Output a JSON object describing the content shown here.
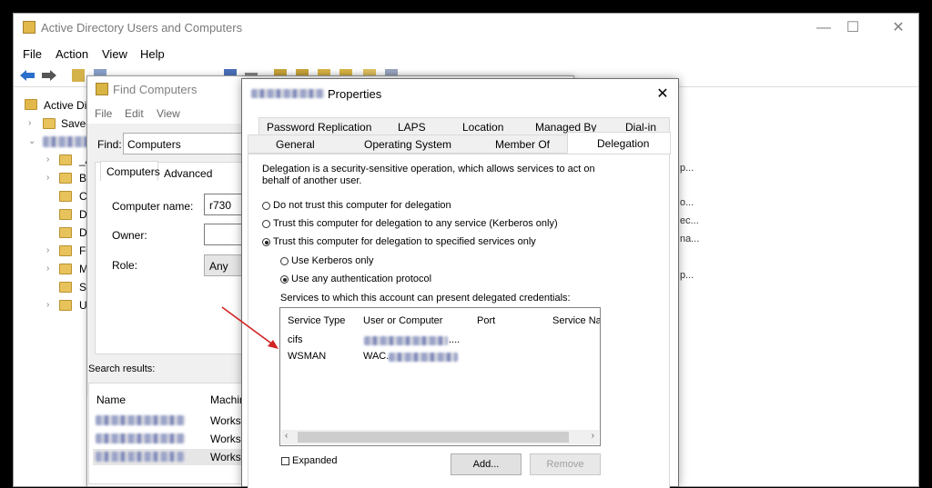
{
  "main": {
    "title": "Active Directory Users and Computers",
    "menu": [
      "File",
      "Action",
      "View",
      "Help"
    ],
    "tree": [
      {
        "label": "Active Direc",
        "name": "tree-root"
      },
      {
        "label": "Saved",
        "name": "tree-saved"
      },
      {
        "label": "",
        "name": "tree-domain"
      },
      {
        "label": "_A",
        "name": "tree-item-a"
      },
      {
        "label": "Bu",
        "name": "tree-item-builtin"
      },
      {
        "label": "Co",
        "name": "tree-item-computers"
      },
      {
        "label": "D",
        "name": "tree-item-d1"
      },
      {
        "label": "D",
        "name": "tree-item-d2"
      },
      {
        "label": "Fo",
        "name": "tree-item-fo"
      },
      {
        "label": "M",
        "name": "tree-item-m"
      },
      {
        "label": "Se",
        "name": "tree-item-se"
      },
      {
        "label": "U",
        "name": "tree-item-u"
      }
    ],
    "right_fragments": [
      "p...",
      "o...",
      "ec...",
      "na...",
      "p..."
    ]
  },
  "find": {
    "title": "Find Computers",
    "menu": [
      "File",
      "Edit",
      "View"
    ],
    "find_label": "Find:",
    "find_value": "Computers",
    "tabs": [
      "Computers",
      "Advanced"
    ],
    "computer_name_label": "Computer name:",
    "computer_name_value": "r730",
    "owner_label": "Owner:",
    "role_label": "Role:",
    "role_value": "Any",
    "search_results_label": "Search results:",
    "columns": [
      "Name",
      "Machin"
    ],
    "rows": [
      "Workst",
      "Workst",
      "Workst"
    ]
  },
  "props": {
    "title": "Properties",
    "tabs_row1": [
      "Password Replication",
      "LAPS",
      "Location",
      "Managed By",
      "Dial-in"
    ],
    "tabs_row2": [
      "General",
      "Operating System",
      "Member Of"
    ],
    "active_tab": "Delegation",
    "description": "Delegation is a security-sensitive operation, which allows services to act on behalf of another user.",
    "options": [
      "Do not trust this computer for delegation",
      "Trust this computer for delegation to any service (Kerberos only)",
      "Trust this computer for delegation to specified services only"
    ],
    "sub_options": [
      "Use Kerberos only",
      "Use any authentication protocol"
    ],
    "services_label": "Services to which this account can present delegated credentials:",
    "columns": [
      "Service Type",
      "User or Computer",
      "Port",
      "Service Na"
    ],
    "services": [
      {
        "type": "cifs",
        "host": "...."
      },
      {
        "type": "WSMAN",
        "host": "WAC..."
      }
    ],
    "expanded_label": "Expanded",
    "add_label": "Add...",
    "remove_label": "Remove"
  },
  "colors": {
    "arrow": "#d32424",
    "folder": "#e8c35c",
    "panel_bg": "#f0f0f0"
  }
}
